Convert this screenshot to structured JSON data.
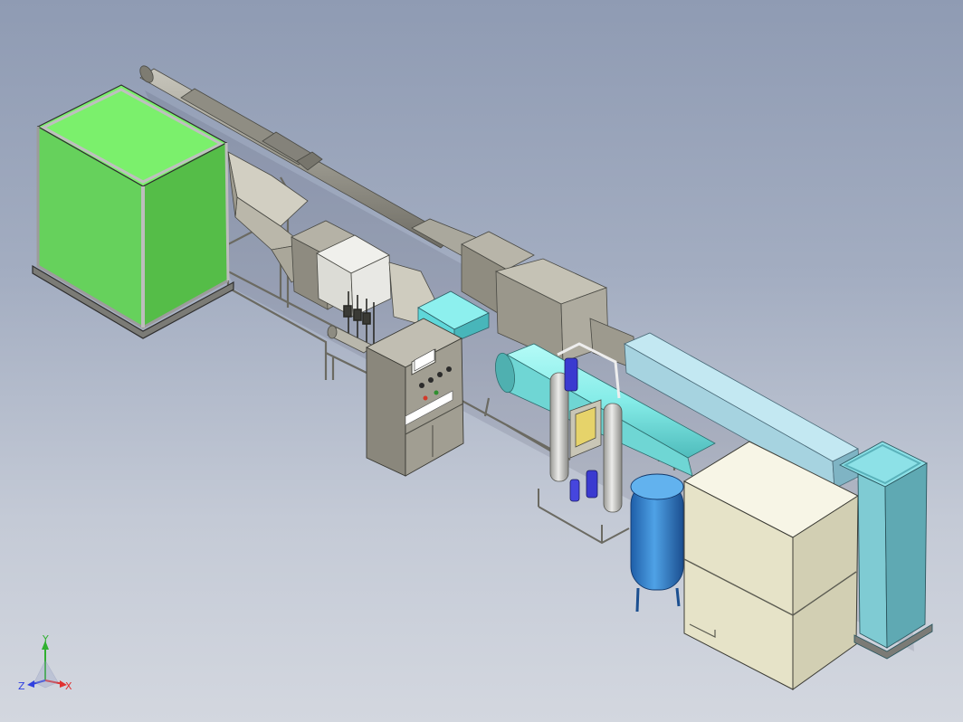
{
  "viewport": {
    "background_top": "#8f9bb3",
    "background_bottom": "#d3d7df"
  },
  "model": {
    "components": [
      {
        "name": "green-enclosure",
        "color": "#6ad95f"
      },
      {
        "name": "exhaust-duct",
        "color": "#9c9a90"
      },
      {
        "name": "hopper",
        "color": "#c9c6b9"
      },
      {
        "name": "filter-housing",
        "color": "#e6e6e6"
      },
      {
        "name": "control-cabinet",
        "color": "#a19e92"
      },
      {
        "name": "cyan-box",
        "color": "#5fd7d9"
      },
      {
        "name": "fan-box",
        "color": "#a9a69a"
      },
      {
        "name": "cyan-cylinder",
        "color": "#8df0ee"
      },
      {
        "name": "gas-cylinders",
        "color": "#d8d8d4"
      },
      {
        "name": "blue-valves",
        "color": "#3a3ad0"
      },
      {
        "name": "blue-tank",
        "color": "#3a8ed6"
      },
      {
        "name": "light-blue-duct",
        "color": "#a6d3e0"
      },
      {
        "name": "beige-box",
        "color": "#efecd3"
      },
      {
        "name": "teal-column",
        "color": "#6ab9c4"
      }
    ]
  },
  "triad": {
    "x_label": "X",
    "y_label": "Y",
    "z_label": "Z",
    "x_color": "#e03030",
    "y_color": "#30b030",
    "z_color": "#3040e0"
  }
}
